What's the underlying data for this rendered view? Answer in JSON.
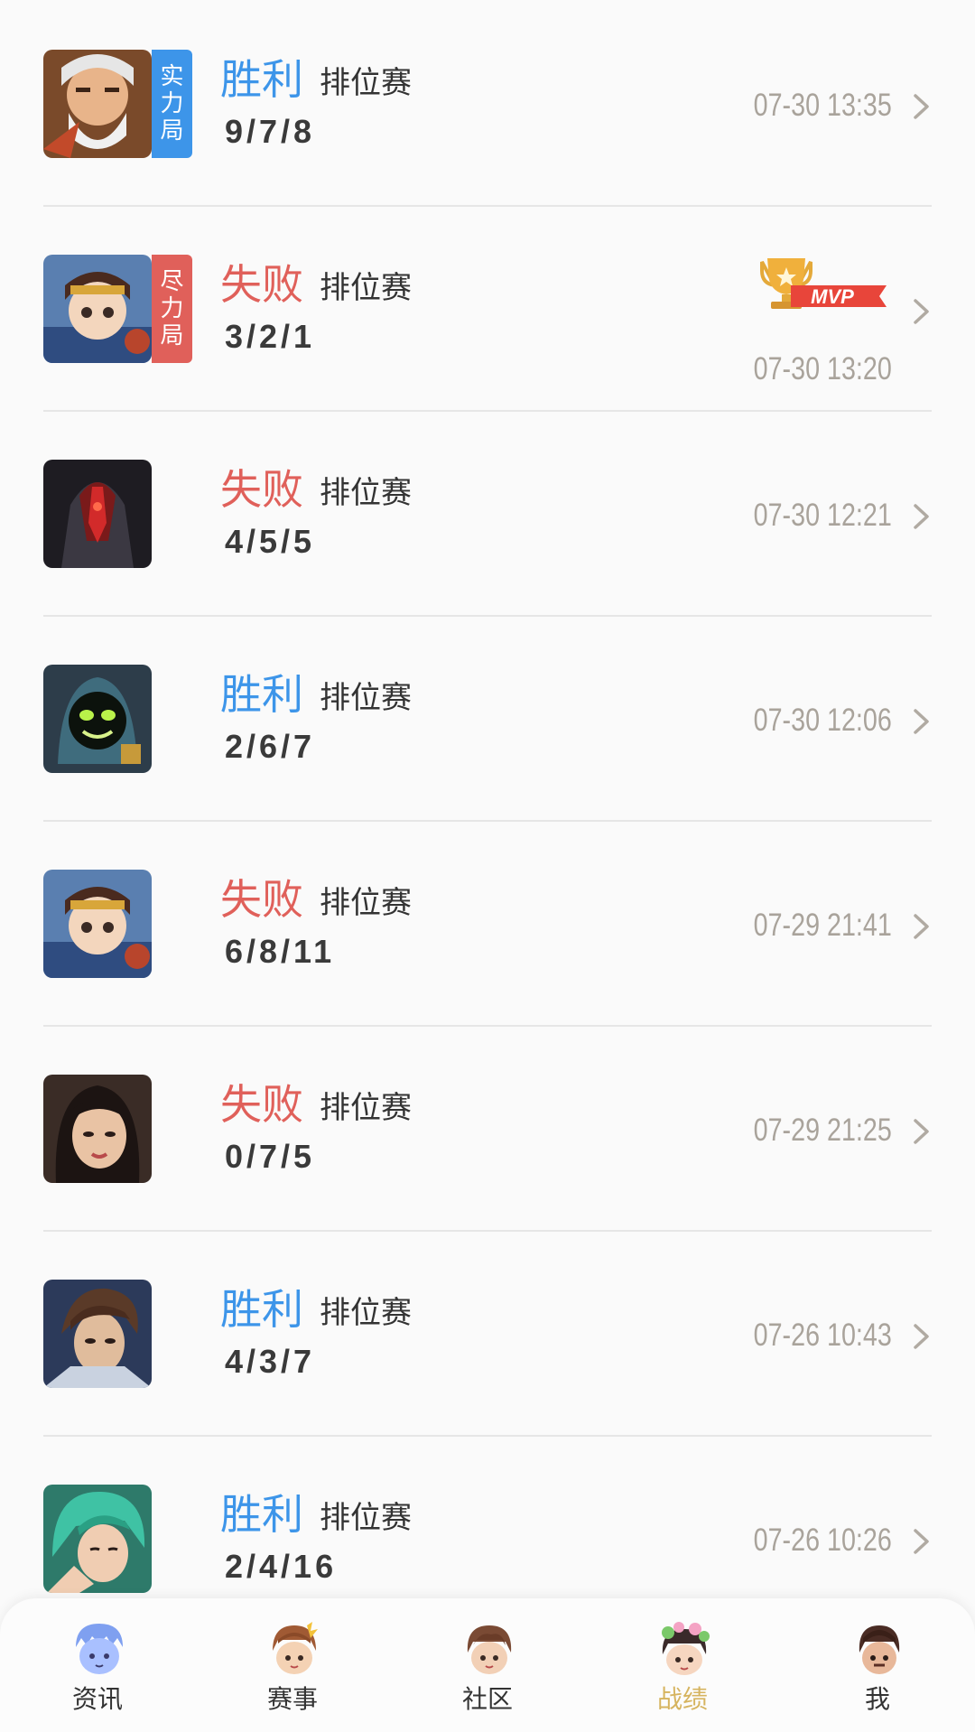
{
  "matches": [
    {
      "result": "胜利",
      "outcome": "win",
      "game_type": "排位赛",
      "kda": "9/7/8",
      "time": "07-30 13:35",
      "mode_tag": "实力局",
      "tag_chars": [
        "实",
        "力",
        "局"
      ],
      "mvp": false,
      "hero_icon": "elder-hero-icon"
    },
    {
      "result": "失败",
      "outcome": "loss",
      "game_type": "排位赛",
      "kda": "3/2/1",
      "time": "07-30 13:20",
      "mode_tag": "尽力局",
      "tag_chars": [
        "尽",
        "力",
        "局"
      ],
      "mvp": true,
      "mvp_label": "MVP",
      "hero_icon": "puppet-girl-hero-icon"
    },
    {
      "result": "失败",
      "outcome": "loss",
      "game_type": "排位赛",
      "kda": "4/5/5",
      "time": "07-30 12:21",
      "mvp": false,
      "hero_icon": "dark-armor-hero-icon"
    },
    {
      "result": "胜利",
      "outcome": "win",
      "game_type": "排位赛",
      "kda": "2/6/7",
      "time": "07-30 12:06",
      "mvp": false,
      "hero_icon": "hooded-hero-icon"
    },
    {
      "result": "失败",
      "outcome": "loss",
      "game_type": "排位赛",
      "kda": "6/8/11",
      "time": "07-29 21:41",
      "mvp": false,
      "hero_icon": "puppet-girl-hero-icon"
    },
    {
      "result": "失败",
      "outcome": "loss",
      "game_type": "排位赛",
      "kda": "0/7/5",
      "time": "07-29 21:25",
      "mvp": false,
      "hero_icon": "dark-hair-girl-hero-icon"
    },
    {
      "result": "胜利",
      "outcome": "win",
      "game_type": "排位赛",
      "kda": "4/3/7",
      "time": "07-26 10:43",
      "mvp": false,
      "hero_icon": "young-swordsman-hero-icon"
    },
    {
      "result": "胜利",
      "outcome": "win",
      "game_type": "排位赛",
      "kda": "2/4/16",
      "time": "07-26 10:26",
      "mvp": false,
      "hero_icon": "green-hair-hero-icon"
    }
  ],
  "tabs": [
    {
      "label": "资讯",
      "icon": "news-mascot-icon",
      "active": false
    },
    {
      "label": "赛事",
      "icon": "events-mascot-icon",
      "active": false
    },
    {
      "label": "社区",
      "icon": "community-mascot-icon",
      "active": false
    },
    {
      "label": "战绩",
      "icon": "records-mascot-icon",
      "active": true
    },
    {
      "label": "我",
      "icon": "me-mascot-icon",
      "active": false
    }
  ],
  "colors": {
    "win": "#3d95e9",
    "loss": "#e0605a",
    "time": "#a9a39b",
    "active_tab": "#d6b45f",
    "background": "#fafafa"
  }
}
